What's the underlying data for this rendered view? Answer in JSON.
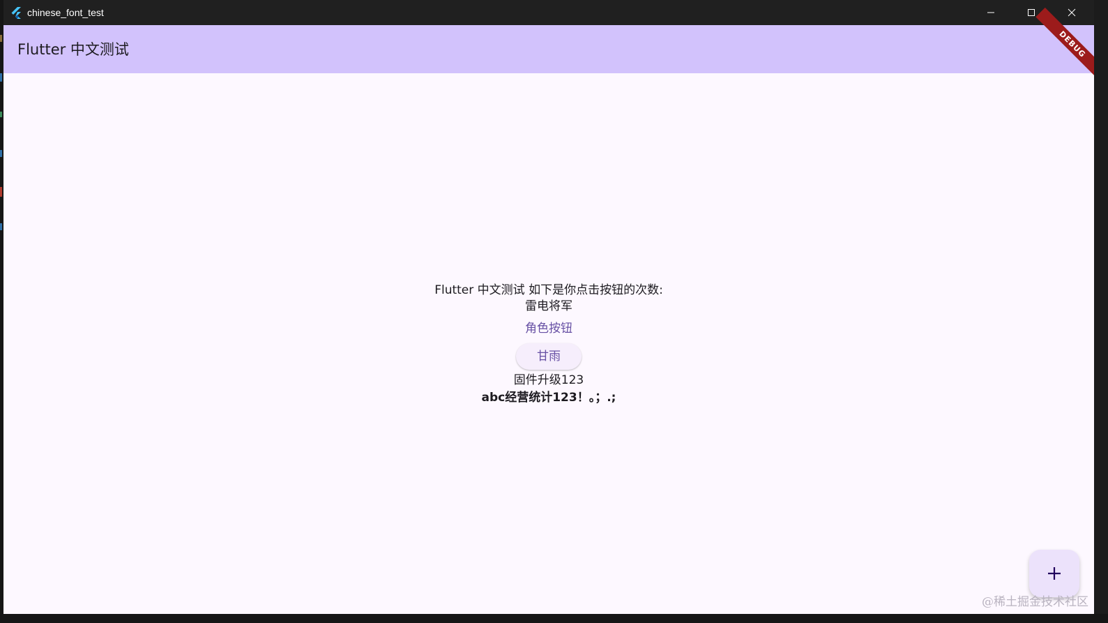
{
  "window": {
    "title": "chinese_font_test",
    "icon": "flutter-logo-icon",
    "controls": [
      "minimize-icon",
      "maximize-icon",
      "close-icon"
    ]
  },
  "appbar": {
    "title": "Flutter 中文测试",
    "banner": "DEBUG"
  },
  "body": {
    "line1": "Flutter 中文测试 如下是你点击按钮的次数:",
    "line2": "雷电将军",
    "text_button": "角色按钮",
    "elevated_button": "甘雨",
    "line3": "固件升级123",
    "line4": "abc经营统计123！。；.;"
  },
  "fab": {
    "icon": "plus-icon"
  },
  "watermark": "@稀土掘金技术社区",
  "colors": {
    "titlebar": "#202020",
    "appbar": "#d2c2fc",
    "background": "#fdf8ff",
    "primary": "#6750a4",
    "debug_banner": "#9c1b1b",
    "fab": "#ece2fb"
  }
}
